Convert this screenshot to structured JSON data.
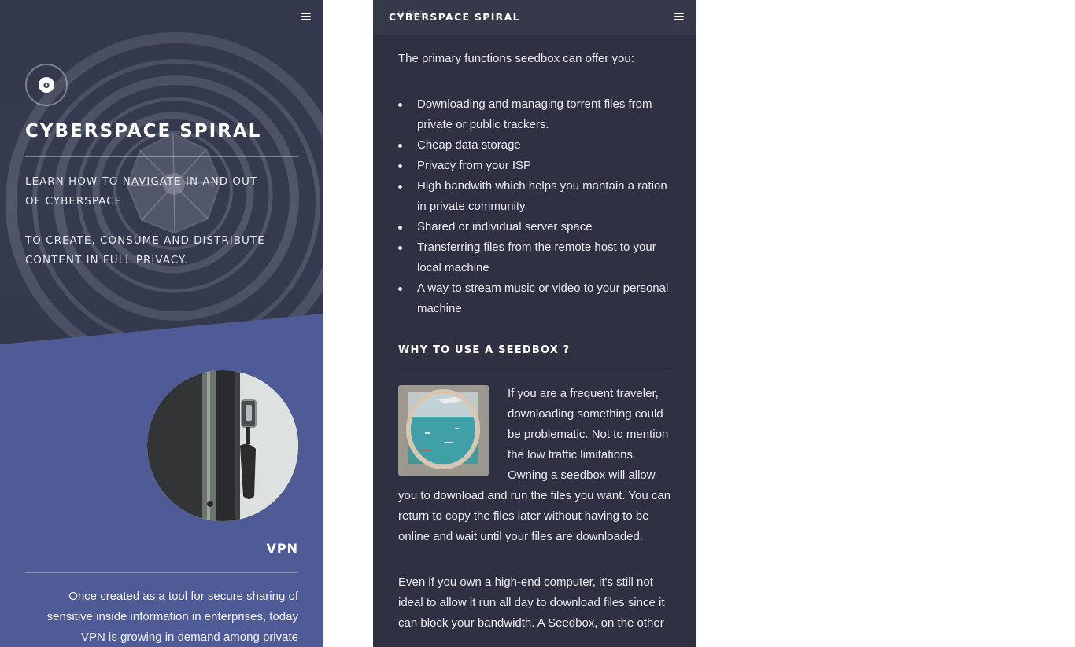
{
  "left": {
    "menu_icon": "hamburger-menu-icon",
    "logo_icon": "stumbleupon-icon",
    "logo_glyph": "ʊ",
    "site_title": "CYBERSPACE SPIRAL",
    "tagline_1": "LEARN HOW TO NAVIGATE IN AND OUT OF CYBERSPACE.",
    "tagline_2": "TO CREATE, CONSUME AND DISTRIBUTE CONTENT IN FULL PRIVACY.",
    "vpn_title": "VPN",
    "vpn_text": "Once created as a tool for secure sharing of sensitive inside information in enterprises, today VPN is growing in demand among private individuals. As"
  },
  "right": {
    "ghost_text": "vices.",
    "bar_title": "CYBERSPACE SPIRAL",
    "menu_icon": "hamburger-menu-icon",
    "intro": "The primary functions seedbox can offer you:",
    "list": [
      "Downloading and managing torrent files from private or public trackers.",
      "Cheap data storage",
      "Privacy from your ISP",
      "High bandwith which helps you mantain a ration in private community",
      "Shared or individual server space",
      "Transferring files from the remote host to your local machine",
      "A way to stream music or video to your personal machine"
    ],
    "section_title": "WHY TO USE A SEEDBOX ?",
    "para_1": "If you are a frequent traveler, downloading something could be problematic. Not to mention the low traffic limitations. Owning a seedbox will allow you to download and run the files you want. You can return to copy the files later without having to be online and wait until your files are downloaded.",
    "para_2": "Even if you own a high-end computer, it's still not ideal to allow it run all day to download files since it can block your bandwidth. A Seedbox, on the other"
  },
  "colors": {
    "left_blue": "#4e5b96",
    "hero_dark": "#3a3f55",
    "right_bg": "#2f3142",
    "topbar": "#363949"
  }
}
